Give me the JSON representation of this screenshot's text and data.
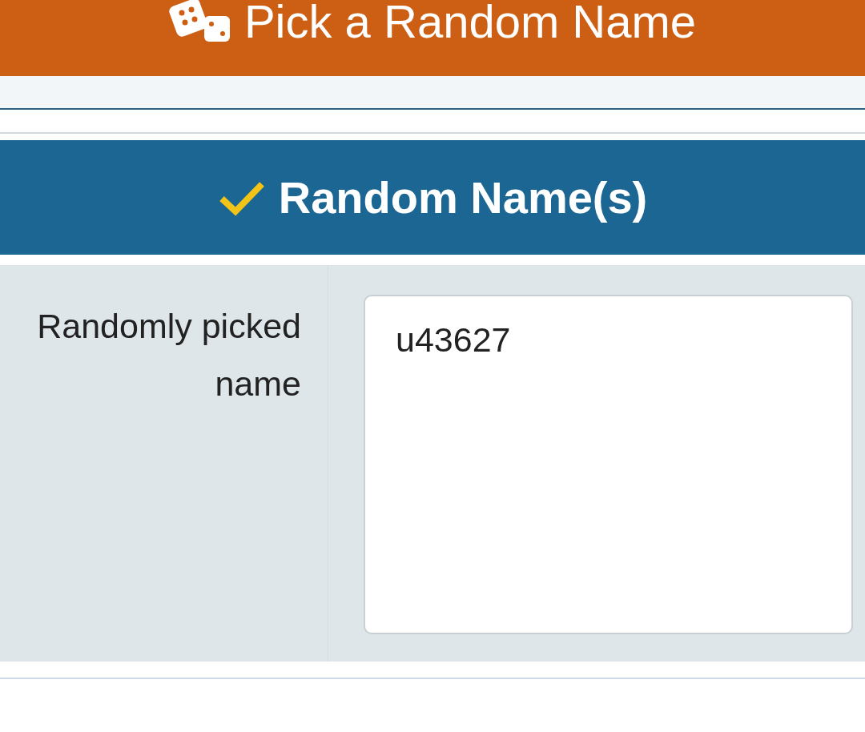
{
  "header": {
    "title": "Pick a Random Name"
  },
  "result_section": {
    "heading": "Random Name(s)",
    "field": {
      "label": "Randomly picked name",
      "value": "u43627"
    }
  }
}
